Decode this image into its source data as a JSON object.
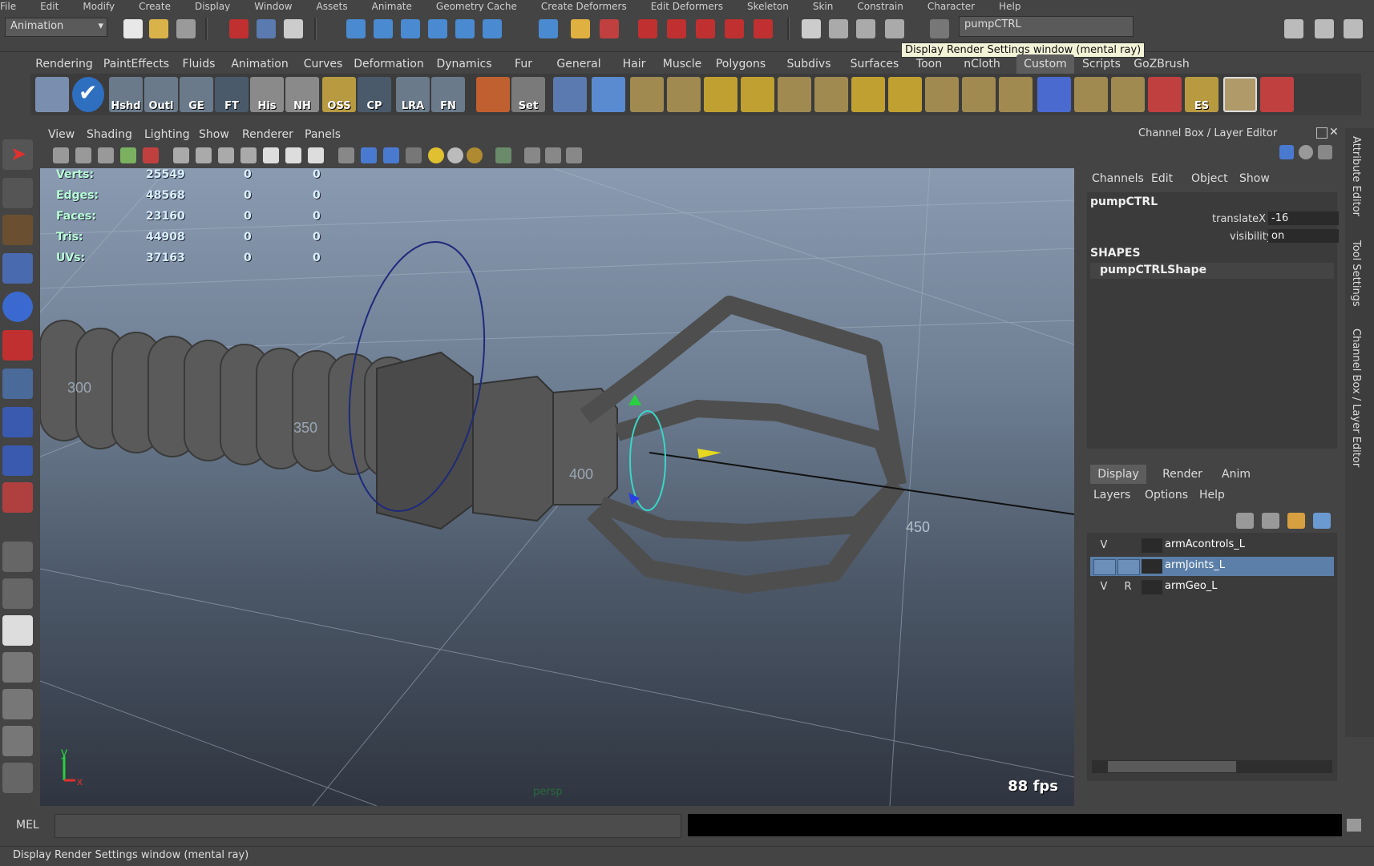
{
  "menubar": {
    "items": [
      "File",
      "Edit",
      "Modify",
      "Create",
      "Display",
      "Window",
      "Assets",
      "Animate",
      "Geometry Cache",
      "Create Deformers",
      "Edit Deformers",
      "Skeleton",
      "Skin",
      "Constrain",
      "Character",
      "Help"
    ]
  },
  "statusline": {
    "mode": "Animation",
    "name_field": "pumpCTRL"
  },
  "tooltip": "Display Render Settings window (mental ray)",
  "shelf": {
    "tabs": [
      "Rendering",
      "PaintEffects",
      "Fluids",
      "Animation",
      "Curves",
      "Deformation",
      "Dynamics",
      "Fur",
      "General",
      "Hair",
      "Muscle",
      "Polygons",
      "Subdivs",
      "Surfaces",
      "Toon",
      "nCloth",
      "Custom",
      "Scripts",
      "GoZBrush"
    ],
    "active_tab": "Custom",
    "button_labels": [
      "Hshd",
      "Outl",
      "GE",
      "FT",
      "His",
      "NH",
      "OSS",
      "CP",
      "LRA",
      "FN",
      "Set",
      "ES"
    ]
  },
  "viewport": {
    "menu": [
      "View",
      "Shading",
      "Lighting",
      "Show",
      "Renderer",
      "Panels"
    ],
    "hud": [
      {
        "label": "Verts:",
        "v1": "25549",
        "v2": "0",
        "v3": "0"
      },
      {
        "label": "Edges:",
        "v1": "48568",
        "v2": "0",
        "v3": "0"
      },
      {
        "label": "Faces:",
        "v1": "23160",
        "v2": "0",
        "v3": "0"
      },
      {
        "label": "Tris:",
        "v1": "44908",
        "v2": "0",
        "v3": "0"
      },
      {
        "label": "UVs:",
        "v1": "37163",
        "v2": "0",
        "v3": "0"
      }
    ],
    "grid_labels": [
      "300",
      "350",
      "400",
      "450"
    ],
    "axis": {
      "y": "y",
      "x": "x"
    },
    "fps": "88 fps",
    "camera": "persp"
  },
  "channelbox": {
    "title": "Channel Box / Layer Editor",
    "menu": [
      "Channels",
      "Edit",
      "Object",
      "Show"
    ],
    "object": "pumpCTRL",
    "attrs": [
      {
        "name": "translateX",
        "value": "-16"
      },
      {
        "name": "visibility",
        "value": "on"
      }
    ],
    "shapes_header": "SHAPES",
    "shape": "pumpCTRLShape"
  },
  "layereditor": {
    "tabs": [
      "Display",
      "Render",
      "Anim"
    ],
    "active_tab": "Display",
    "menu": [
      "Layers",
      "Options",
      "Help"
    ],
    "layers": [
      {
        "v": "V",
        "r": "",
        "name": "armAcontrols_L",
        "selected": false
      },
      {
        "v": "",
        "r": "",
        "name": "armJoints_L",
        "selected": true
      },
      {
        "v": "V",
        "r": "R",
        "name": "armGeo_L",
        "selected": false
      }
    ]
  },
  "sidetabs": [
    "Attribute Editor",
    "Tool Settings",
    "Channel Box / Layer Editor"
  ],
  "commandline": {
    "label": "MEL"
  },
  "statusbar": {
    "text": "Display Render Settings window (mental ray)"
  },
  "colors": {
    "viewport_top": "#8a9bb1",
    "viewport_bottom": "#2f3540",
    "selection": "#5b7fa8",
    "hud_text": "#d8f0ff"
  }
}
